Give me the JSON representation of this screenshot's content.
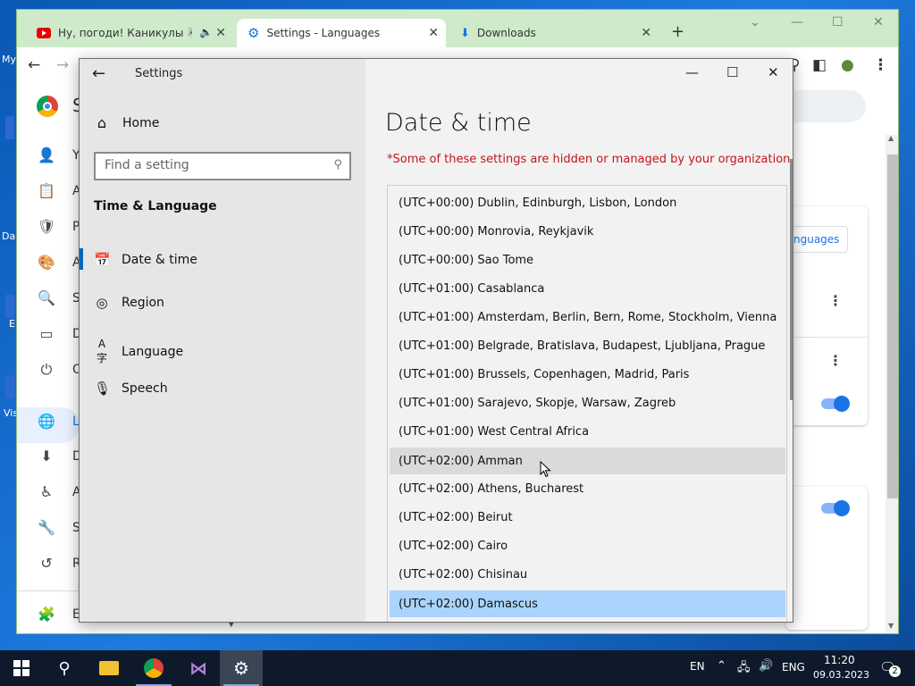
{
  "desktop": {
    "labels": [
      "My",
      "Da",
      "E",
      "Vis"
    ]
  },
  "chrome": {
    "tabs": [
      {
        "title": "Ну, погоди! Каникулы 🐺 П",
        "close": "✕",
        "icon": "youtube-icon",
        "audio_icon": "speaker-icon"
      },
      {
        "title": "Settings - Languages",
        "close": "✕",
        "icon": "gear-icon"
      },
      {
        "title": "Downloads",
        "close": "✕",
        "icon": "download-icon"
      }
    ],
    "new_tab": "+",
    "sidebar_letters": [
      "Y",
      "A",
      "P",
      "A",
      "S",
      "D",
      "O",
      "L",
      "D",
      "A",
      "S",
      "R",
      "E"
    ],
    "languages_button": "nguages",
    "accent": "#1a73e8"
  },
  "settings": {
    "window_title": "Settings",
    "home_label": "Home",
    "search_placeholder": "Find a setting",
    "section_title": "Time & Language",
    "nav": [
      {
        "label": "Date & time",
        "icon": "calendar-clock-icon"
      },
      {
        "label": "Region",
        "icon": "globe-icon"
      },
      {
        "label": "Language",
        "icon": "language-icon"
      },
      {
        "label": "Speech",
        "icon": "microphone-icon"
      }
    ],
    "page_title": "Date & time",
    "warning": "*Some of these settings are hidden or managed by your organization.",
    "warning_color": "#c4151c",
    "timezones": [
      "(UTC+00:00) Dublin, Edinburgh, Lisbon, London",
      "(UTC+00:00) Monrovia, Reykjavik",
      "(UTC+00:00) Sao Tome",
      "(UTC+01:00) Casablanca",
      "(UTC+01:00) Amsterdam, Berlin, Bern, Rome, Stockholm, Vienna",
      "(UTC+01:00) Belgrade, Bratislava, Budapest, Ljubljana, Prague",
      "(UTC+01:00) Brussels, Copenhagen, Madrid, Paris",
      "(UTC+01:00) Sarajevo, Skopje, Warsaw, Zagreb",
      "(UTC+01:00) West Central Africa",
      "(UTC+02:00) Amman",
      "(UTC+02:00) Athens, Bucharest",
      "(UTC+02:00) Beirut",
      "(UTC+02:00) Cairo",
      "(UTC+02:00) Chisinau",
      "(UTC+02:00) Damascus"
    ],
    "hovered_timezone": "(UTC+02:00) Amman",
    "selected_timezone": "(UTC+02:00) Damascus",
    "selected_color": "#aad4fb"
  },
  "taskbar": {
    "lang_short": "EN",
    "lang_long": "ENG",
    "time": "11:20",
    "date": "09.03.2023",
    "notifications": "2"
  }
}
